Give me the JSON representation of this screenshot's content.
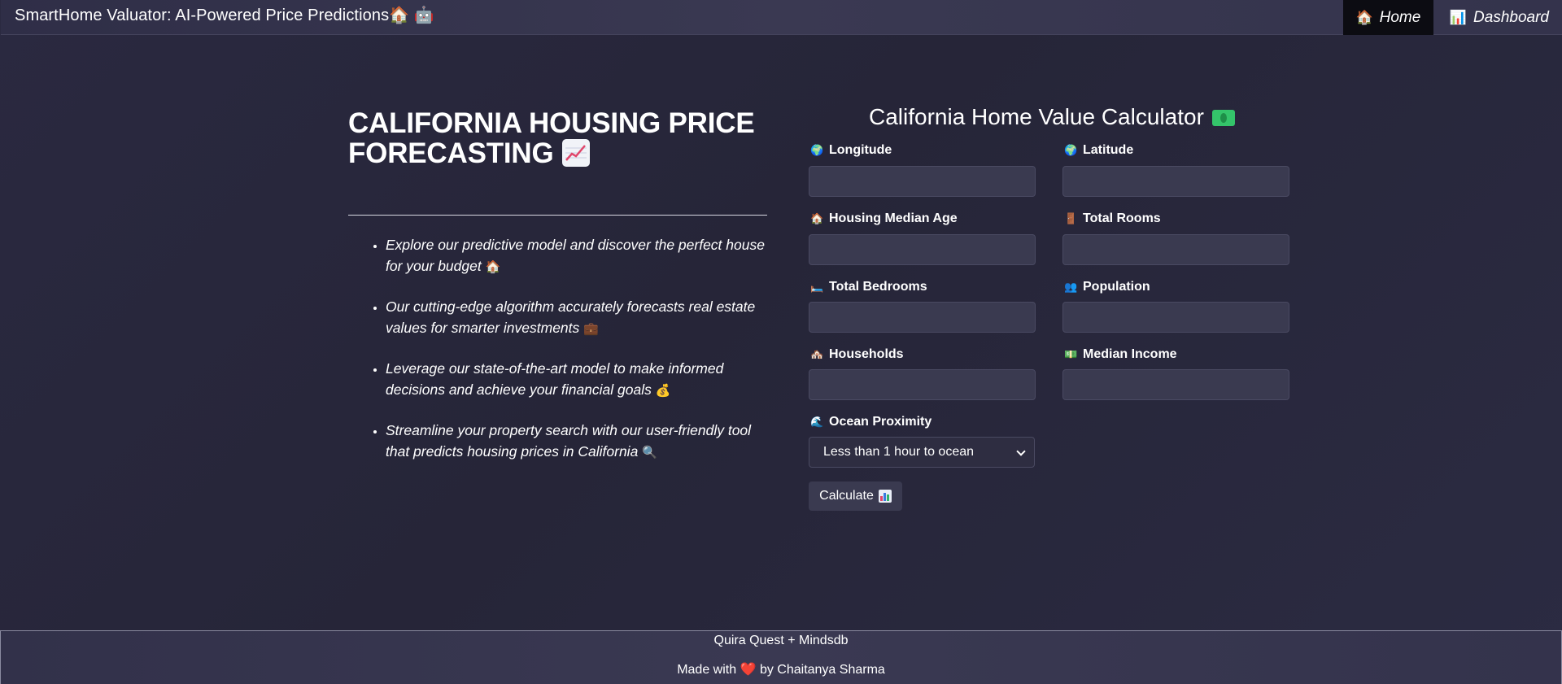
{
  "header": {
    "brand": "SmartHome Valuator: AI-Powered Price Predictions🏠 🤖",
    "nav": [
      {
        "icon": "🏠",
        "label": "Home",
        "active": true
      },
      {
        "icon": "📊",
        "label": "Dashboard",
        "active": false
      }
    ]
  },
  "hero": {
    "title": "CALIFORNIA HOUSING PRICE FORECASTING",
    "title_icon": "chart-increasing-icon",
    "features": [
      {
        "text": "Explore our predictive model and discover the perfect house for your budget",
        "emoji": "🏠"
      },
      {
        "text": "Our cutting-edge algorithm accurately forecasts real estate values for smarter investments",
        "emoji": "💼"
      },
      {
        "text": "Leverage our state-of-the-art model to make informed decisions and achieve your financial goals",
        "emoji": "💰"
      },
      {
        "text": "Streamline your property search with our user-friendly tool that predicts housing prices in California",
        "emoji": "🔍"
      }
    ]
  },
  "calculator": {
    "title": "California Home Value Calculator",
    "title_icon": "money-icon",
    "fields": {
      "longitude": {
        "label": "Longitude",
        "icon": "🌍",
        "value": ""
      },
      "latitude": {
        "label": "Latitude",
        "icon": "🌍",
        "value": ""
      },
      "housing_median_age": {
        "label": "Housing Median Age",
        "icon": "🏠",
        "value": ""
      },
      "total_rooms": {
        "label": "Total Rooms",
        "icon": "🚪",
        "value": ""
      },
      "total_bedrooms": {
        "label": "Total Bedrooms",
        "icon": "🛏️",
        "value": ""
      },
      "population": {
        "label": "Population",
        "icon": "👥",
        "value": ""
      },
      "households": {
        "label": "Households",
        "icon": "🏘️",
        "value": ""
      },
      "median_income": {
        "label": "Median Income",
        "icon": "💵",
        "value": ""
      }
    },
    "ocean_proximity": {
      "label": "Ocean Proximity",
      "icon": "🌊",
      "selected": "Less than 1 hour to ocean"
    },
    "calculate_label": "Calculate"
  },
  "footer": {
    "line1": "Quira Quest + Mindsdb",
    "made_with": "Made with",
    "heart": "❤️",
    "by": "by Chaitanya Sharma"
  },
  "colors": {
    "background": "#272639",
    "navbar": "#37364f",
    "active_nav": "#0c0c12",
    "input": "#3a3a50"
  }
}
